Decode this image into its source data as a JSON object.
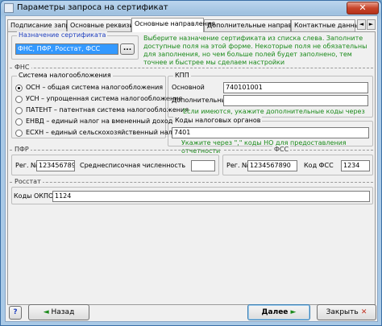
{
  "window": {
    "title": "Параметры запроса на сертификат",
    "close_glyph": "✕"
  },
  "tabs": [
    {
      "label": "Подписание запроса"
    },
    {
      "label": "Основные реквизиты"
    },
    {
      "label": "Основные направления"
    },
    {
      "label": "Дополнительные направления"
    },
    {
      "label": "Контактные данные"
    }
  ],
  "tab_scroll": {
    "left": "◄",
    "right": "►"
  },
  "purpose": {
    "legend": "Назначение сертификата",
    "value": "ФНС, ПФР, Росстат, ФСС",
    "browse_label": "...",
    "hint": "Выберите назначение сертификата из списка слева. Заполните доступные поля на этой форме. Некоторые поля не обязательны для заполнения, но чем больше полей будет заполнено, тем точнее и быстрее мы  сделаем настройки"
  },
  "fns": {
    "section": "ФНС",
    "tax_legend": "Система налогообложения",
    "tax_options": [
      {
        "label": "ОСН – общая система налогообложения",
        "selected": true
      },
      {
        "label": "УСН – упрощенная система налогообложения",
        "selected": false
      },
      {
        "label": "ПАТЕНТ – патентная система налогообложения",
        "selected": false
      },
      {
        "label": "ЕНВД – единый налог на вмененный доход",
        "selected": false
      },
      {
        "label": "ЕСХН – единый сельскохозяйственный налог",
        "selected": false
      }
    ],
    "kpp_legend": "КПП",
    "kpp_main_label": "Основной",
    "kpp_main_value": "740101001",
    "kpp_extra_label": "Дополнительные",
    "kpp_extra_value": "",
    "kpp_hint": "Если имеются, укажите дополнительные коды через \",\"",
    "tax_codes_legend": "Коды налоговых органов",
    "tax_codes_value": "7401",
    "tax_codes_hint": "Укажите через \",\" коды НО для предоставления отчетности"
  },
  "pfr": {
    "section": "ПФР",
    "reg_label": "Рег. №",
    "reg_value": "123456789",
    "headcount_label": "Среднесписочная численность",
    "headcount_value": ""
  },
  "fss": {
    "section": "ФСС",
    "reg_label": "Рег. №",
    "reg_value": "1234567890",
    "code_label": "Код ФСС",
    "code_value": "1234"
  },
  "rosstat": {
    "section": "Росстат",
    "okpo_label": "Коды ОКПО",
    "okpo_value": "1124"
  },
  "footer": {
    "help_label": "?",
    "back_label": "Назад",
    "next_label": "Далее",
    "close_label": "Закрыть"
  },
  "colors": {
    "hint_green": "#1a8a1a",
    "legend_blue": "#1f3fbf",
    "selection": "#3399ff"
  }
}
